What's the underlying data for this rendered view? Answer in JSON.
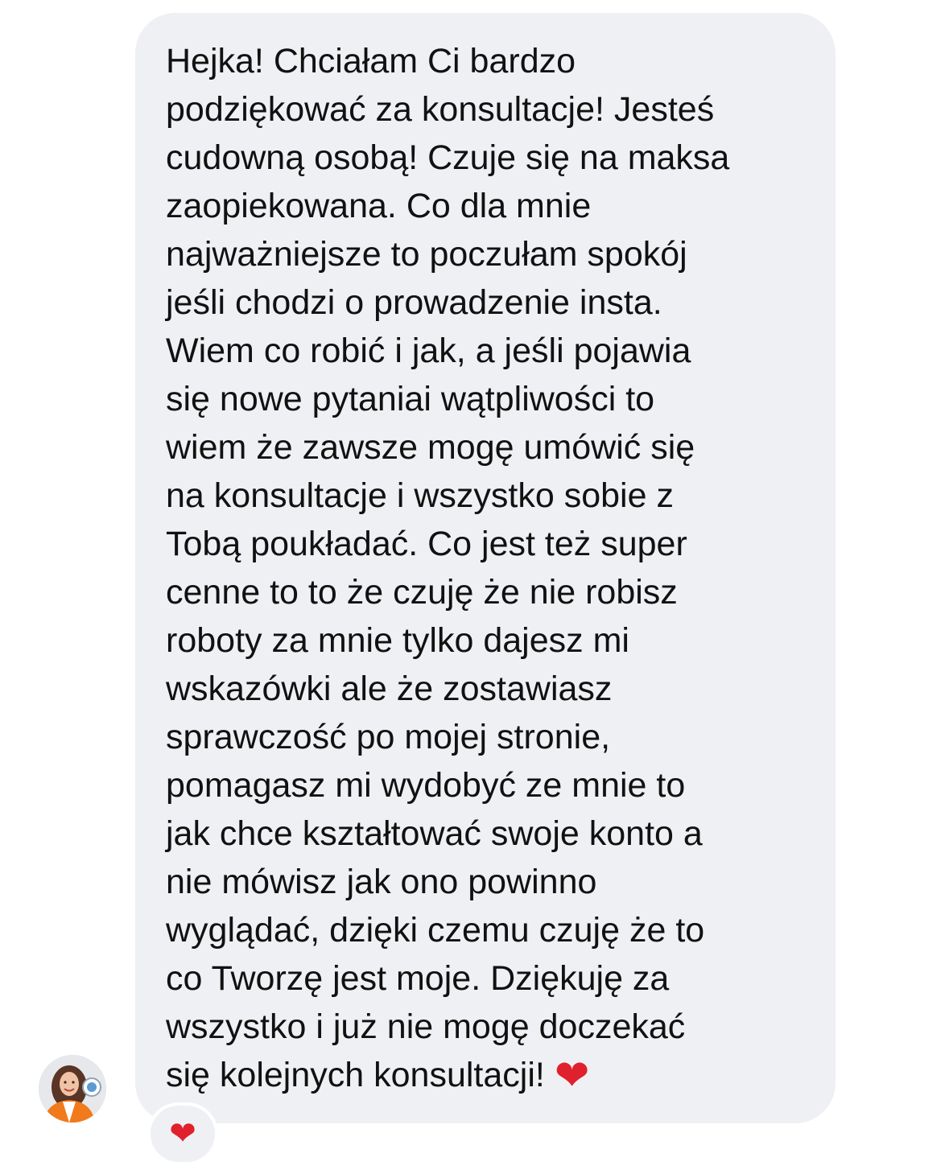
{
  "message": {
    "lines": [
      "Hejka! Chciałam Ci bardzo",
      "podziękować za konsultacje! Jesteś",
      "cudowną osobą! Czuje się na maksa",
      "zaopiekowana. Co dla mnie",
      "najważniejsze to poczułam spokój",
      "jeśli chodzi o prowadzenie insta.",
      "Wiem co robić i jak, a jeśli pojawia",
      "się nowe pytaniai wątpliwości to",
      "wiem że zawsze mogę umówić się",
      "na konsultacje i wszystko sobie z",
      "Tobą poukładać. Co jest też super",
      "cenne to to że czuję że nie robisz",
      "roboty za mnie tylko dajesz mi",
      "wskazówki ale że zostawiasz",
      "sprawczość po mojej stronie,",
      "pomagasz mi wydobyć ze mnie to",
      "jak chce kształtować swoje konto a",
      "nie mówisz jak ono powinno",
      "wyglądać, dzięki czemu czuję że to",
      "co Tworzę jest moje. Dziękuję za",
      "wszystko i już nie mogę doczekać",
      "się kolejnych konsultacji!"
    ],
    "end_emoji": "❤"
  },
  "reaction": {
    "emoji": "❤"
  },
  "avatar": {
    "icon": "profile-photo"
  },
  "colors": {
    "bubble": "#eff0f3",
    "text": "#111111",
    "heart": "#e0202c"
  }
}
